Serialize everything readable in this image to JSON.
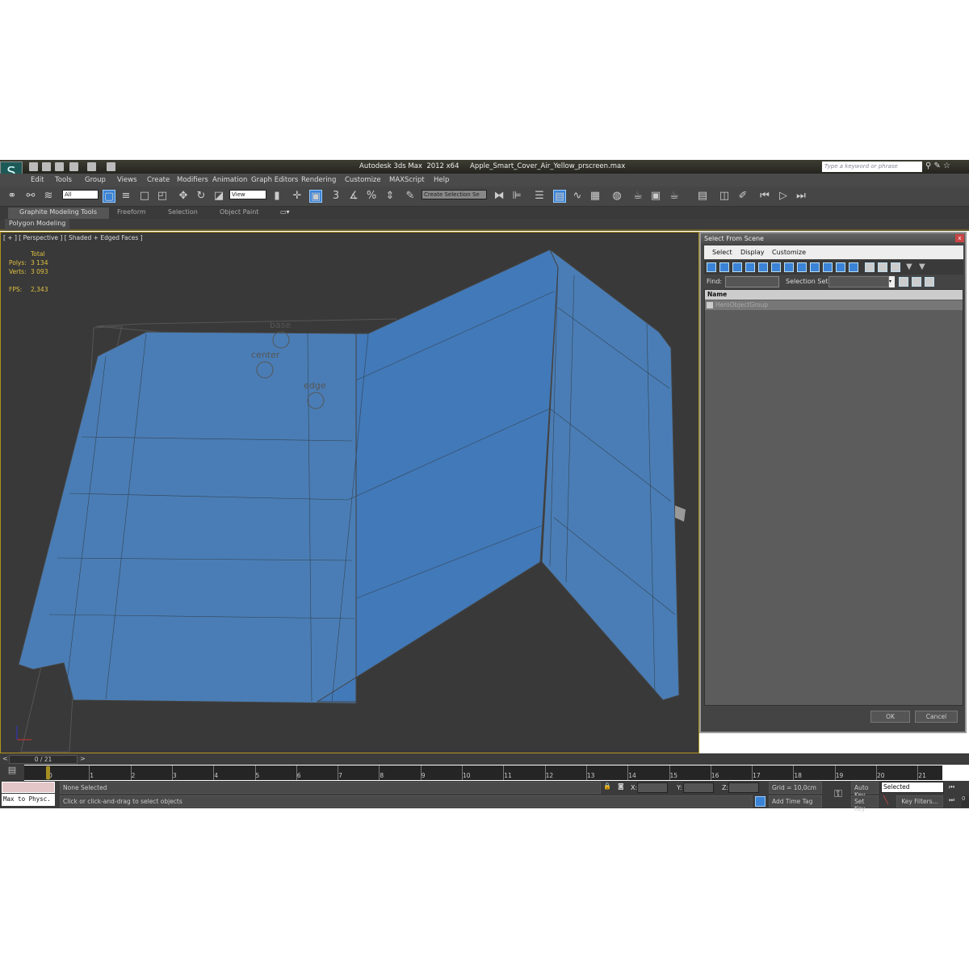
{
  "app": {
    "title": "Autodesk 3ds Max  2012 x64     Apple_Smart_Cover_Air_Yellow_prscreen.max",
    "search_placeholder": "Type a keyword or phrase"
  },
  "menu": [
    "Edit",
    "Tools",
    "Group",
    "Views",
    "Create",
    "Modifiers",
    "Animation",
    "Graph Editors",
    "Rendering",
    "Customize",
    "MAXScript",
    "Help"
  ],
  "toolbar": {
    "filter": "All",
    "ref_coord": "View",
    "selection_set": "Create Selection Se",
    "snap_labels": [
      "3",
      "%"
    ]
  },
  "ribbon": {
    "tabs": [
      "Graphite Modeling Tools",
      "Freeform",
      "Selection",
      "Object Paint"
    ],
    "panel": "Polygon Modeling"
  },
  "viewport": {
    "label": "[ + ] [ Perspective ] [ Shaded + Edged Faces ]",
    "stats": {
      "total": "Total",
      "polys_label": "Polys:",
      "polys": "3 134",
      "verts_label": "Verts:",
      "verts": "3 093",
      "fps_label": "FPS:",
      "fps": "2,343"
    },
    "helpers": [
      "base",
      "center",
      "edge"
    ],
    "model_color": "#4a7db5"
  },
  "dialog": {
    "title": "Select From Scene",
    "menu": [
      "Select",
      "Display",
      "Customize"
    ],
    "find_label": "Find:",
    "selset_label": "Selection Set:",
    "column": "Name",
    "rows": [
      "HeroObjectGroup"
    ],
    "ok": "OK",
    "cancel": "Cancel"
  },
  "timeline": {
    "slider": "0 / 21",
    "ticks": [
      "0",
      "1",
      "2",
      "3",
      "4",
      "5",
      "6",
      "7",
      "8",
      "9",
      "10",
      "11",
      "12",
      "13",
      "14",
      "15",
      "16",
      "17",
      "18",
      "19",
      "20",
      "21"
    ]
  },
  "status": {
    "script_listener": "Max to Physc.",
    "selected": "None Selected",
    "prompt": "Click or click-and-drag to select objects",
    "x": "X:",
    "y": "Y:",
    "z": "Z:",
    "grid": "Grid = 10,0cm",
    "add_time_tag": "Add Time Tag",
    "auto_key": "Auto Key",
    "set_key": "Set Key",
    "key_mode": "Selected",
    "key_filters": "Key Filters...",
    "frame": "0"
  }
}
